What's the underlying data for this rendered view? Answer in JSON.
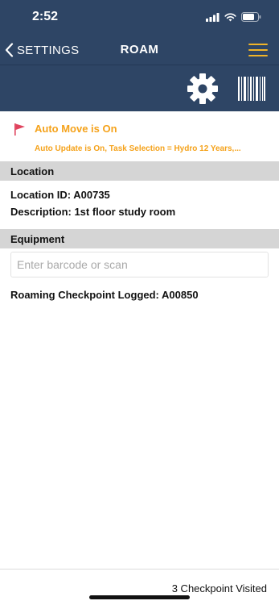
{
  "status_bar": {
    "time": "2:52"
  },
  "nav": {
    "back_label": "SETTINGS",
    "title": "ROAM"
  },
  "toolbar": {
    "settings_icon": "gear-icon",
    "barcode_icon": "barcode-icon"
  },
  "alert": {
    "title": "Auto Move is On",
    "subtitle": "Auto Update is On, Task Selection = Hydro 12 Years,..."
  },
  "location": {
    "header": "Location",
    "id_line": "Location ID: A00735",
    "description_line": "Description: 1st floor study room"
  },
  "equipment": {
    "header": "Equipment",
    "input_placeholder": "Enter barcode or scan",
    "input_value": "",
    "logged_line": "Roaming Checkpoint Logged: A00850"
  },
  "footer": {
    "status": "3 Checkpoint Visited"
  },
  "colors": {
    "header_bg": "#2e4565",
    "accent": "#f5a21a",
    "menu_accent": "#f0b429",
    "flag": "#e0445e",
    "section_bg": "#d5d5d5"
  }
}
